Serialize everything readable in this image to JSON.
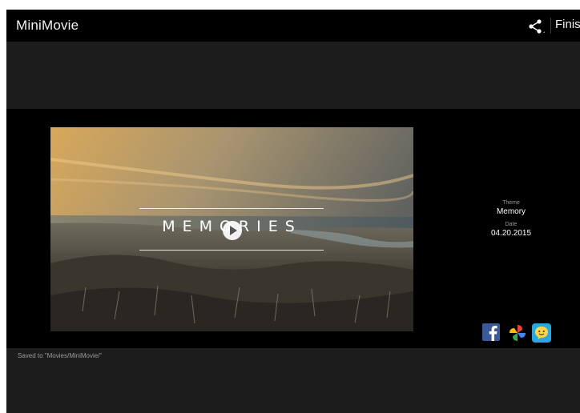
{
  "appbar": {
    "title": "MiniMovie",
    "share_icon": "share-icon",
    "finish_label": "Finish"
  },
  "video": {
    "title_text": "MEMORIES",
    "play_icon": "play-icon"
  },
  "meta": {
    "theme_label": "Theme",
    "theme_value": "Memory",
    "date_label": "Date",
    "date_value": "04.20.2015"
  },
  "social": {
    "items": [
      {
        "name": "facebook",
        "icon": "facebook-icon",
        "color": "#3b5998"
      },
      {
        "name": "photos",
        "icon": "pinwheel-icon",
        "color": "#f4b400"
      },
      {
        "name": "messenger",
        "icon": "smiley-chat-icon",
        "color": "#29a8e0"
      }
    ]
  },
  "status": {
    "saved_text": "Saved to \"Movies/MiniMovie/\""
  },
  "colors": {
    "bar": "#000000",
    "band": "#1c1c1c",
    "stage": "#000000",
    "text": "#ffffff",
    "muted": "#9a9a9a"
  }
}
